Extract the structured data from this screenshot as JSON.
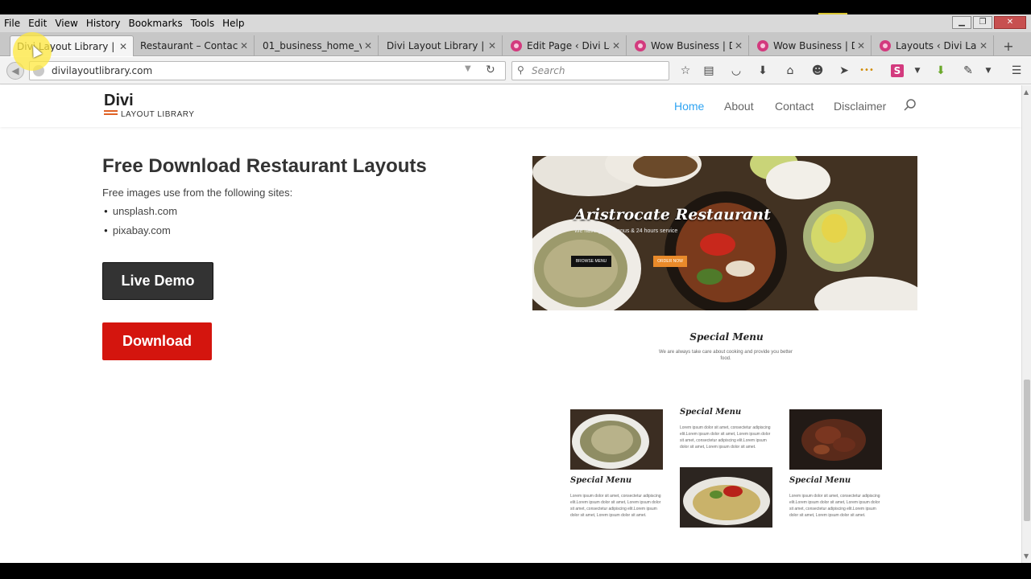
{
  "menubar": {
    "items": [
      "File",
      "Edit",
      "View",
      "History",
      "Bookmarks",
      "Tools",
      "Help"
    ]
  },
  "tabs": [
    {
      "title": "Divi Layout Library | Fr...",
      "active": true
    },
    {
      "title": "Restaurant – Contact |..."
    },
    {
      "title": "01_business_home_ve..."
    },
    {
      "title": "Divi Layout Library | Fr..."
    },
    {
      "title": "Edit Page ‹ Divi La..."
    },
    {
      "title": "Wow Business | Di..."
    },
    {
      "title": "Wow Business | Di..."
    },
    {
      "title": "Layouts ‹ Divi Lay..."
    }
  ],
  "navbar": {
    "url": "divilayoutlibrary.com",
    "search_placeholder": "Search"
  },
  "site": {
    "logo_main": "Divi",
    "logo_sub": "LAYOUT LIBRARY",
    "nav": [
      "Home",
      "About",
      "Contact",
      "Disclaimer"
    ],
    "active_nav": "Home",
    "accent_color": "#2ea3f2"
  },
  "content": {
    "headline": "Free Download Restaurant Layouts",
    "intro": "Free images use from the following sites:",
    "sources": [
      "unsplash.com",
      "pixabay.com"
    ],
    "live_demo_label": "Live Demo",
    "download_label": "Download",
    "download_color": "#d4150e"
  },
  "preview": {
    "hero_title": "Aristrocate Restaurant",
    "hero_sub": "We have great menus & 24 hours service",
    "hero_btn1": "BROWSE MENU",
    "hero_btn2": "ORDER NOW",
    "special_title": "Special Menu",
    "special_desc": "We are always take care about cooking and provide you better food.",
    "grid": [
      {
        "caption": "Special Menu",
        "text": "Lorem ipsum dolor sit amet, consectetur adipiscing elit.Lorem ipsum dolor sit amet, Lorem ipsum dolor sit amet, consectetur adipiscing elit.Lorem ipsum dolor sit amet, Lorem ipsum dolor sit amet."
      },
      {
        "caption": "Special Menu",
        "text": "Lorem ipsum dolor sit amet, consectetur adipiscing elit.Lorem ipsum dolor sit amet, Lorem ipsum dolor sit amet, consectetur adipiscing elit.Lorem ipsum dolor sit amet, Lorem ipsum dolor sit amet."
      },
      {
        "caption": "Special Menu",
        "text": "Lorem ipsum dolor sit amet, consectetur adipiscing elit.Lorem ipsum dolor sit amet, Lorem ipsum dolor sit amet, consectetur adipiscing elit.Lorem ipsum dolor sit amet, Lorem ipsum dolor sit amet."
      }
    ]
  }
}
